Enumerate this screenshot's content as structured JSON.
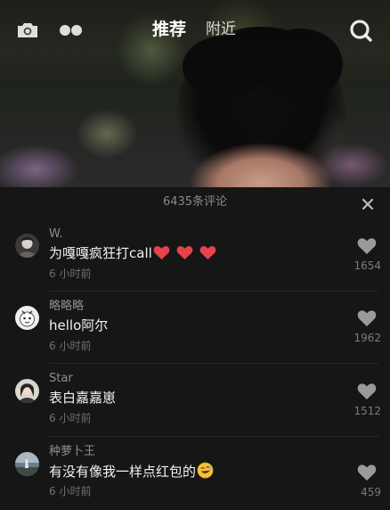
{
  "header": {
    "tabs": [
      {
        "label": "推荐",
        "active": true
      },
      {
        "label": "附近",
        "active": false
      }
    ],
    "icons": {
      "left_1": "camera-icon",
      "left_2": "dots-icon",
      "right": "search-icon"
    }
  },
  "comments_panel": {
    "title": "6435条评论",
    "close_icon": "close-icon",
    "comments": [
      {
        "user": "W.",
        "text": "为嘎嘎疯狂打call",
        "trailing_emoji": "heart-emoji x3",
        "time": "6 小时前",
        "likes": "1654"
      },
      {
        "user": "略略略",
        "text": "hello阿尔",
        "time": "6 小时前",
        "likes": "1962"
      },
      {
        "user": "Star",
        "text": "表白嘉嘉崽",
        "time": "6 小时前",
        "likes": "1512"
      },
      {
        "user": "种萝卜王",
        "text": "有没有像我一样点红包的",
        "trailing_emoji": "laughing-emoji",
        "time": "6 小时前",
        "likes": "459"
      }
    ]
  },
  "colors": {
    "sheet_bg": "#161616",
    "heart_red": "#e8424d",
    "like_icon": "#9a9a9a"
  }
}
